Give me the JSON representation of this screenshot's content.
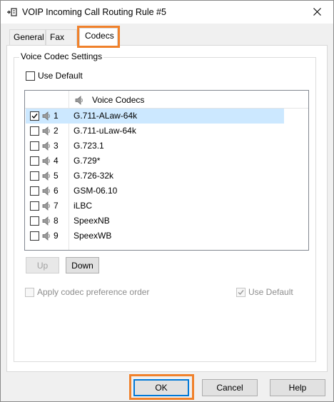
{
  "window": {
    "title": "VOIP Incoming Call Routing Rule #5"
  },
  "tabs": [
    {
      "label": "General"
    },
    {
      "label": "Fax"
    },
    {
      "label": "Codecs"
    }
  ],
  "group": {
    "label": "Voice Codec Settings",
    "use_default_top": {
      "label": "Use Default",
      "checked": false
    }
  },
  "list": {
    "header": "Voice Codecs",
    "rows": [
      {
        "num": "1",
        "name": "G.711-ALaw-64k",
        "checked": true,
        "selected": true
      },
      {
        "num": "2",
        "name": "G.711-uLaw-64k",
        "checked": false,
        "selected": false
      },
      {
        "num": "3",
        "name": "G.723.1",
        "checked": false,
        "selected": false
      },
      {
        "num": "4",
        "name": "G.729*",
        "checked": false,
        "selected": false
      },
      {
        "num": "5",
        "name": "G.726-32k",
        "checked": false,
        "selected": false
      },
      {
        "num": "6",
        "name": "GSM-06.10",
        "checked": false,
        "selected": false
      },
      {
        "num": "7",
        "name": "iLBC",
        "checked": false,
        "selected": false
      },
      {
        "num": "8",
        "name": "SpeexNB",
        "checked": false,
        "selected": false
      },
      {
        "num": "9",
        "name": "SpeexWB",
        "checked": false,
        "selected": false
      }
    ]
  },
  "order_buttons": {
    "up": "Up",
    "down": "Down"
  },
  "preference": {
    "apply_label": "Apply codec preference order",
    "use_default_label": "Use Default",
    "use_default_checked": true
  },
  "footer": {
    "ok": "OK",
    "cancel": "Cancel",
    "help": "Help"
  },
  "colors": {
    "highlight": "#f0812b",
    "selection": "#cce8ff",
    "default_button": "#0078d7"
  }
}
